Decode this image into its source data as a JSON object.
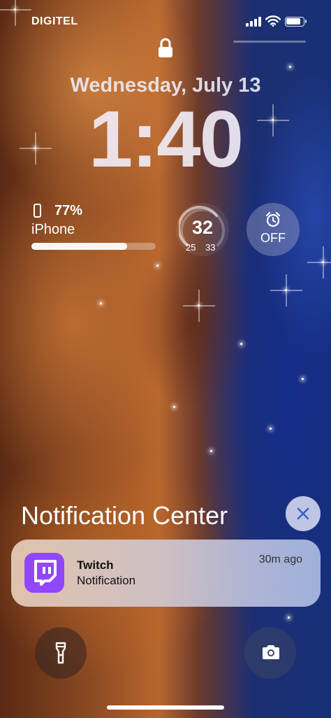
{
  "status_bar": {
    "carrier": "DIGITEL",
    "icons": [
      "signal-icon",
      "wifi-icon",
      "battery-icon"
    ],
    "battery_level": 0.85
  },
  "lock_screen": {
    "lock_icon": "lock-icon",
    "date": "Wednesday, July 13",
    "time": "1:40"
  },
  "widgets": {
    "battery": {
      "icon": "iphone-icon",
      "percent": "77%",
      "device": "iPhone",
      "level": 0.77
    },
    "weather": {
      "current": "32",
      "low": "25",
      "high": "33"
    },
    "alarm": {
      "icon": "alarm-clock-icon",
      "label": "OFF"
    }
  },
  "notification_center": {
    "title": "Notification Center",
    "close_icon": "close-icon",
    "notifications": [
      {
        "app": "Twitch",
        "body": "Notification",
        "time": "30m ago",
        "icon": "twitch-icon",
        "icon_color": "#9146ff"
      }
    ]
  },
  "quick_actions": {
    "left": "flashlight-icon",
    "right": "camera-icon"
  }
}
